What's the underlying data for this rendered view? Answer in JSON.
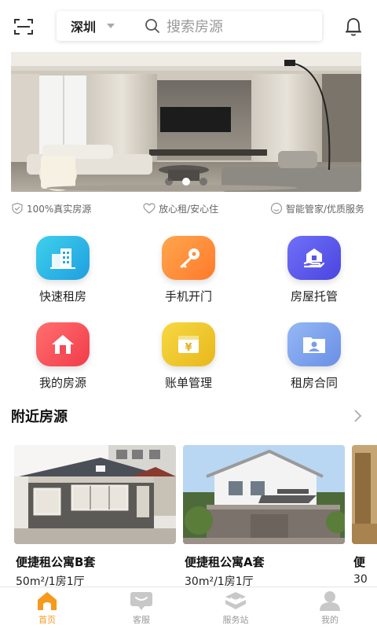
{
  "header": {
    "scan_icon": "scan-icon",
    "city": "深圳",
    "search_placeholder": "搜索房源",
    "bell_icon": "bell-icon"
  },
  "banner": {
    "description_icon": "living-room-photo",
    "dots_count": 3,
    "active_dot": 2
  },
  "features": [
    {
      "icon": "shield-check-icon",
      "label": "100%真实房源"
    },
    {
      "icon": "heart-icon",
      "label": "放心租/安心住"
    },
    {
      "icon": "smile-icon",
      "label": "智能管家/优质服务"
    }
  ],
  "grid": [
    {
      "label": "快速租房",
      "icon": "building-icon",
      "color_from": "#36c9e8",
      "color_to": "#1f9fe0"
    },
    {
      "label": "手机开门",
      "icon": "key-icon",
      "color_from": "#ffa14a",
      "color_to": "#ff7a2b"
    },
    {
      "label": "房屋托管",
      "icon": "house-hand-icon",
      "color_from": "#6c6cf5",
      "color_to": "#4a45e0"
    },
    {
      "label": "我的房源",
      "icon": "home-icon",
      "color_from": "#ff6a6a",
      "color_to": "#f23b4a"
    },
    {
      "label": "账单管理",
      "icon": "bill-icon",
      "color_from": "#f5d23a",
      "color_to": "#e8b81c"
    },
    {
      "label": "租房合同",
      "icon": "contract-icon",
      "color_from": "#8fb4f2",
      "color_to": "#6a8fe6"
    }
  ],
  "nearby": {
    "title": "附近房源",
    "more_icon": "chevron-right-icon",
    "listings": [
      {
        "title": "便捷租公寓B套",
        "sub": "50m²/1房1厅"
      },
      {
        "title": "便捷租公寓A套",
        "sub": "30m²/1房1厅"
      },
      {
        "title": "便",
        "sub": "30"
      }
    ]
  },
  "tabbar": [
    {
      "label": "首页",
      "icon": "home-tab-icon",
      "active": true
    },
    {
      "label": "客服",
      "icon": "chat-icon",
      "active": false
    },
    {
      "label": "服务站",
      "icon": "service-icon",
      "active": false
    },
    {
      "label": "我的",
      "icon": "user-icon",
      "active": false
    }
  ],
  "colors": {
    "accent": "#f59a1c",
    "tab_inactive": "#c8c8c8"
  }
}
